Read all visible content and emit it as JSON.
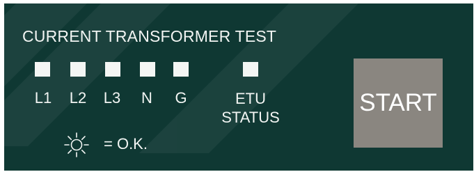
{
  "panel": {
    "title": "CURRENT TRANSFORMER TEST",
    "background_color": "#0f3833",
    "text_color": "#f2f5f3",
    "indicators": [
      {
        "label": "L1",
        "lit": true
      },
      {
        "label": "L2",
        "lit": true
      },
      {
        "label": "L3",
        "lit": true
      },
      {
        "label": "N",
        "lit": true
      },
      {
        "label": "G",
        "lit": true
      }
    ],
    "etu_status": {
      "line1": "ETU",
      "line2": "STATUS",
      "lit": true
    },
    "legend": {
      "icon": "sun-icon",
      "text": "= O.K."
    },
    "start_button": {
      "label": "START",
      "color": "#8a8680"
    }
  }
}
